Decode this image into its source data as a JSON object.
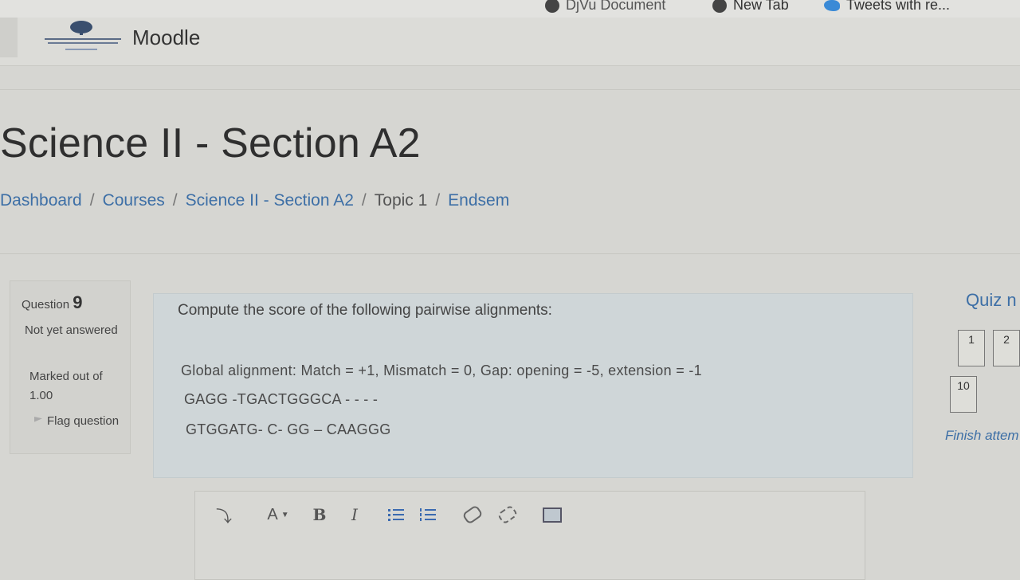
{
  "browser": {
    "bookmarks": [
      {
        "label": "DjVu Document",
        "icon": "globe-icon"
      },
      {
        "label": "New Tab",
        "icon": "globe-icon"
      },
      {
        "label": "Tweets with re...",
        "icon": "twitter-bird-icon"
      }
    ]
  },
  "navbar": {
    "brand": "Moodle"
  },
  "page": {
    "title": "Science II - Section A2"
  },
  "breadcrumb": [
    {
      "label": "Dashboard",
      "link": true
    },
    {
      "label": "Courses",
      "link": true
    },
    {
      "label": "Science II - Section A2",
      "link": true
    },
    {
      "label": "Topic 1",
      "link": false
    },
    {
      "label": "Endsem",
      "link": true
    }
  ],
  "breadcrumb_separator": "/",
  "question": {
    "prefix": "Question",
    "number": "9",
    "state": "Not yet answered",
    "grade": "Marked out of 1.00",
    "flag_label": "Flag question",
    "text": "Compute the score of the following pairwise alignments:",
    "scoring": "Global alignment: Match = +1, Mismatch = 0, Gap: opening = -5, extension = -1",
    "sequence_1": "GAGG -TGACTGGGCA - - - -",
    "sequence_2": "GTGGATG- C- GG – CAAGGG"
  },
  "editor": {
    "toolbar": [
      {
        "name": "expand-toolbar-icon",
        "glyph": "⤵"
      },
      {
        "name": "font-color-button",
        "glyph": "A"
      },
      {
        "name": "bold-button",
        "glyph": "B"
      },
      {
        "name": "italic-button",
        "glyph": "I"
      },
      {
        "name": "unordered-list-icon"
      },
      {
        "name": "ordered-list-icon"
      },
      {
        "name": "link-icon"
      },
      {
        "name": "unlink-icon"
      },
      {
        "name": "insert-image-icon"
      }
    ]
  },
  "quiz_nav": {
    "title": "Quiz n",
    "buttons": [
      "1",
      "2",
      "10"
    ],
    "finish": "Finish attem"
  },
  "colors": {
    "link": "#3d6fa6",
    "page_bg": "#d6d6d2",
    "content_bg": "#cfd6d8"
  }
}
